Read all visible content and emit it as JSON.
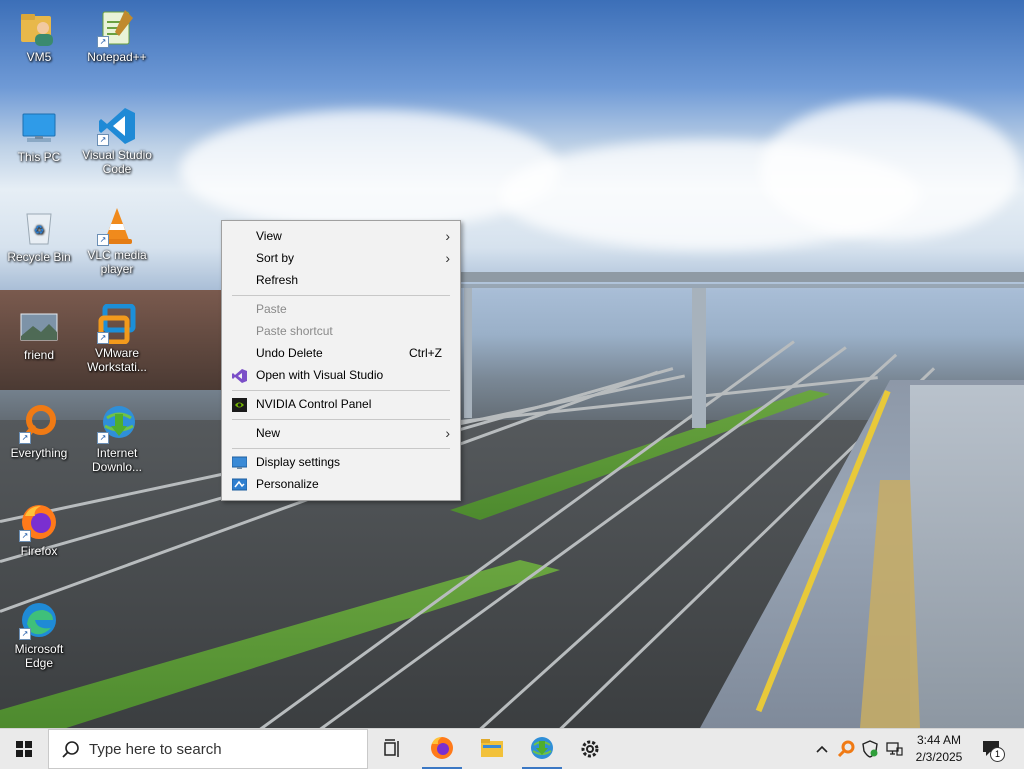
{
  "desktop": {
    "icons": [
      {
        "label": "VM5"
      },
      {
        "label": "Notepad++"
      },
      {
        "label": "This PC"
      },
      {
        "label": "Visual Studio Code"
      },
      {
        "label": "Recycle Bin"
      },
      {
        "label": "VLC media player"
      },
      {
        "label": "friend"
      },
      {
        "label": "VMware Workstati..."
      },
      {
        "label": "Everything"
      },
      {
        "label": "Internet Downlo..."
      },
      {
        "label": "Firefox"
      },
      {
        "label": "Microsoft Edge"
      }
    ]
  },
  "context_menu": {
    "items": [
      {
        "label": "View",
        "has_submenu": true
      },
      {
        "label": "Sort by",
        "has_submenu": true
      },
      {
        "label": "Refresh"
      },
      {
        "label": "Paste",
        "disabled": true
      },
      {
        "label": "Paste shortcut",
        "disabled": true
      },
      {
        "label": "Undo Delete",
        "shortcut": "Ctrl+Z"
      },
      {
        "label": "Open with Visual Studio",
        "icon": "visual-studio-icon"
      },
      {
        "label": "NVIDIA Control Panel",
        "icon": "nvidia-icon"
      },
      {
        "label": "New",
        "has_submenu": true
      },
      {
        "label": "Display settings",
        "icon": "display-icon"
      },
      {
        "label": "Personalize",
        "icon": "personalize-icon"
      }
    ]
  },
  "taskbar": {
    "search_placeholder": "Type here to search",
    "clock_time": "3:44 AM",
    "clock_date": "2/3/2025",
    "notification_count": "1",
    "pinned": [
      "task-view-icon",
      "firefox-icon",
      "file-explorer-icon",
      "internet-download-manager-icon",
      "settings-gear-icon"
    ]
  },
  "colors": {
    "accent": "#3b78c4",
    "menu_bg": "#f2f2f2",
    "taskbar_bg": "#eaeaea"
  }
}
